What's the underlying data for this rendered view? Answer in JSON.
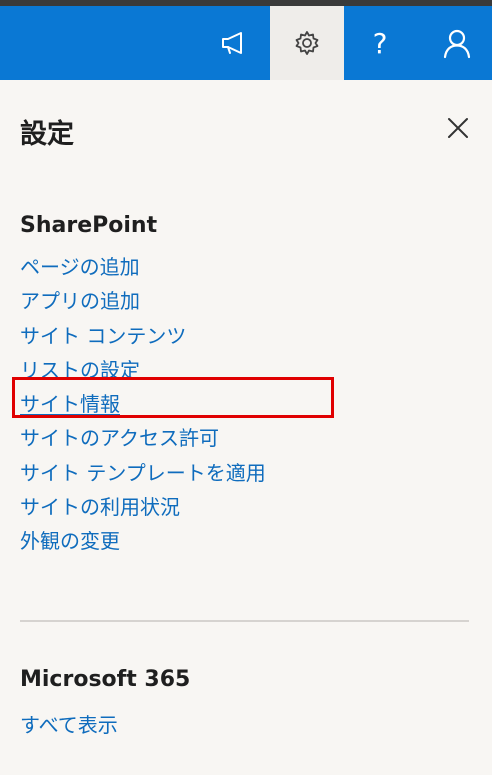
{
  "header": {
    "icons": [
      "megaphone-icon",
      "gear-icon",
      "question-icon",
      "person-icon"
    ],
    "active": "gear-icon",
    "help_glyph": "?",
    "bar_color": "#0a78d4"
  },
  "panel": {
    "title": "設定",
    "close_glyph": "×"
  },
  "sharepoint": {
    "heading": "SharePoint",
    "links": [
      "ページの追加",
      "アプリの追加",
      "サイト コンテンツ",
      "リストの設定",
      "サイト情報",
      "サイトのアクセス許可",
      "サイト テンプレートを適用",
      "サイトの利用状況",
      "外観の変更"
    ],
    "highlighted_link": "サイト情報",
    "link_color": "#0f6cbd",
    "highlight_color": "#e00000"
  },
  "microsoft365": {
    "heading": "Microsoft 365",
    "link": "すべて表示"
  }
}
